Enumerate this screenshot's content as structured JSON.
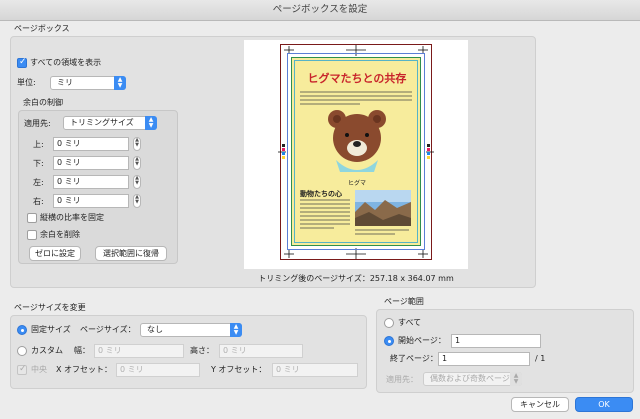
{
  "window": {
    "title": "ページボックスを設定"
  },
  "page_boxes": {
    "section_label": "ページボックス",
    "show_all_boxes_label": "すべての領域を表示",
    "units_label": "単位:",
    "units_value": "ミリ",
    "margin_control": {
      "label": "余白の制御",
      "apply_to_label": "適用先:",
      "apply_to_value": "トリミングサイズ",
      "top_label": "上:",
      "top_value": "0 ミリ",
      "bottom_label": "下:",
      "bottom_value": "0 ミリ",
      "left_label": "左:",
      "left_value": "0 ミリ",
      "right_label": "右:",
      "right_value": "0 ミリ",
      "keep_ratio_label": "縦横の比率を固定",
      "remove_white_label": "余白を削除",
      "set_zero_button": "ゼロに設定",
      "revert_button": "選択範囲に復帰"
    },
    "preview": {
      "title": "ヒグマたちとの共存",
      "bear_caption": "ヒグマ",
      "subheading": "動物たちの心",
      "trim_size_text": "トリミング後のページサイズ：257.18 x 364.07 mm"
    }
  },
  "page_size": {
    "section_label": "ページサイズを変更",
    "fixed_size_label": "固定サイズ",
    "page_size_label": "ページサイズ：",
    "page_size_value": "なし",
    "custom_label": "カスタム",
    "width_label": "幅：",
    "width_placeholder": "0 ミリ",
    "height_label": "高さ：",
    "height_placeholder": "0 ミリ",
    "center_label": "中央",
    "x_offset_label": "X オフセット：",
    "x_offset_placeholder": "0 ミリ",
    "y_offset_label": "Y オフセット：",
    "y_offset_placeholder": "0 ミリ"
  },
  "page_range": {
    "section_label": "ページ範囲",
    "all_label": "すべて",
    "start_page_label": "開始ページ：",
    "start_page_value": "1",
    "end_page_label": "終了ページ：",
    "end_page_value": "1",
    "total_pages": "/ 1",
    "apply_to_label": "適用先：",
    "apply_to_value": "偶数および奇数ページ"
  },
  "buttons": {
    "cancel": "キャンセル",
    "ok": "OK"
  },
  "colors": {
    "accent": "#3b8cf3",
    "page_border": "#7a1a1a",
    "art_background": "#f7ec9c",
    "title_red": "#c8242b",
    "bear_brown": "#8a4a2e"
  }
}
